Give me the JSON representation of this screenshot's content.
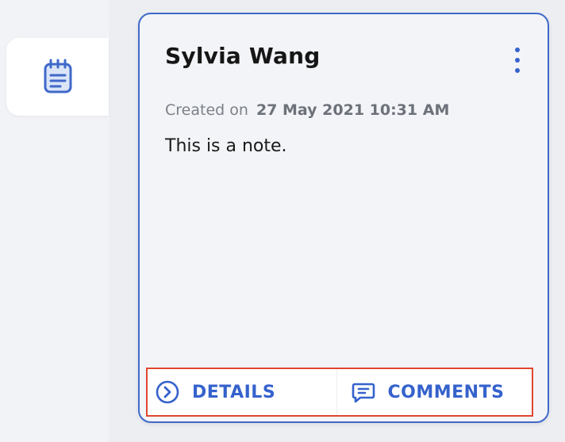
{
  "nav": {
    "active_icon": "notepad-icon"
  },
  "note": {
    "author": "Sylvia Wang",
    "created_label": "Created on",
    "created_date": "27 May 2021 10:31 AM",
    "body": "This is a note.",
    "menu_icon": "more-vertical-icon"
  },
  "actions": {
    "details_label": "DETAILS",
    "details_icon": "chevron-circle-right-icon",
    "comments_label": "COMMENTS",
    "comments_icon": "comment-icon"
  },
  "colors": {
    "accent": "#3562cc",
    "card_border": "#3f69c9",
    "highlight_border": "#e0462f"
  }
}
